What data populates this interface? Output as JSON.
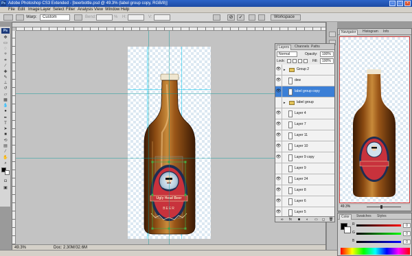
{
  "window": {
    "title": "Adobe Photoshop CS3 Extended - [beerbottle.psd @ 49.3% (label group copy, RGB/8)]",
    "app_badge": "Ps"
  },
  "menu": [
    "File",
    "Edit",
    "Image",
    "Layer",
    "Select",
    "Filter",
    "Analysis",
    "View",
    "Window",
    "Help"
  ],
  "options_bar": {
    "warp_label": "Warp:",
    "warp_value": "Custom",
    "bend_label": "Bend:",
    "bend_value": "%",
    "h_label": "H:",
    "v_label": "V:",
    "workspace_label": "Workspace"
  },
  "canvas": {
    "label_title": "Ugly Head Beer",
    "label_sub": "BEER"
  },
  "status": {
    "zoom": "49.3%",
    "doc": "Doc: 2.30M/32.6M"
  },
  "layers_panel": {
    "tabs": [
      "Layers",
      "Channels",
      "Paths"
    ],
    "blend_mode": "Normal",
    "opacity_label": "Opacity:",
    "opacity_value": "100%",
    "lock_label": "Lock:",
    "fill_label": "Fill:",
    "fill_value": "100%",
    "layers": [
      {
        "name": "Group 2",
        "type": "group",
        "visible": true,
        "selected": false
      },
      {
        "name": "dew",
        "type": "layer",
        "visible": true,
        "selected": false
      },
      {
        "name": "label group copy",
        "type": "layer",
        "visible": true,
        "selected": true
      },
      {
        "name": "label group",
        "type": "group",
        "visible": false,
        "selected": false
      },
      {
        "name": "Layer 4",
        "type": "layer",
        "visible": true,
        "selected": false
      },
      {
        "name": "Layer 7",
        "type": "layer",
        "visible": true,
        "selected": false
      },
      {
        "name": "Layer 11",
        "type": "layer",
        "visible": true,
        "selected": false
      },
      {
        "name": "Layer 10",
        "type": "layer",
        "visible": true,
        "selected": false
      },
      {
        "name": "Layer 9 copy",
        "type": "layer",
        "visible": true,
        "selected": false
      },
      {
        "name": "Layer 9",
        "type": "layer",
        "visible": false,
        "selected": false
      },
      {
        "name": "Layer 24",
        "type": "layer",
        "visible": true,
        "selected": false
      },
      {
        "name": "Layer 8",
        "type": "layer",
        "visible": true,
        "selected": false
      },
      {
        "name": "Layer 6",
        "type": "layer",
        "visible": true,
        "selected": false
      },
      {
        "name": "Layer 5",
        "type": "layer",
        "visible": true,
        "selected": false
      }
    ]
  },
  "navigator_panel": {
    "tabs": [
      "Navigator",
      "Histogram",
      "Info"
    ],
    "zoom": "49.3%"
  },
  "color_panel": {
    "tabs": [
      "Color",
      "Swatches",
      "Styles"
    ],
    "values": [
      "0",
      "0",
      "0"
    ],
    "labels": [
      "R",
      "G",
      "B"
    ]
  },
  "colors": {
    "bottle": "#7a3e0c",
    "label_red": "#c8323c",
    "label_navy": "#1f2d52",
    "selection": "#3b7fd6"
  }
}
